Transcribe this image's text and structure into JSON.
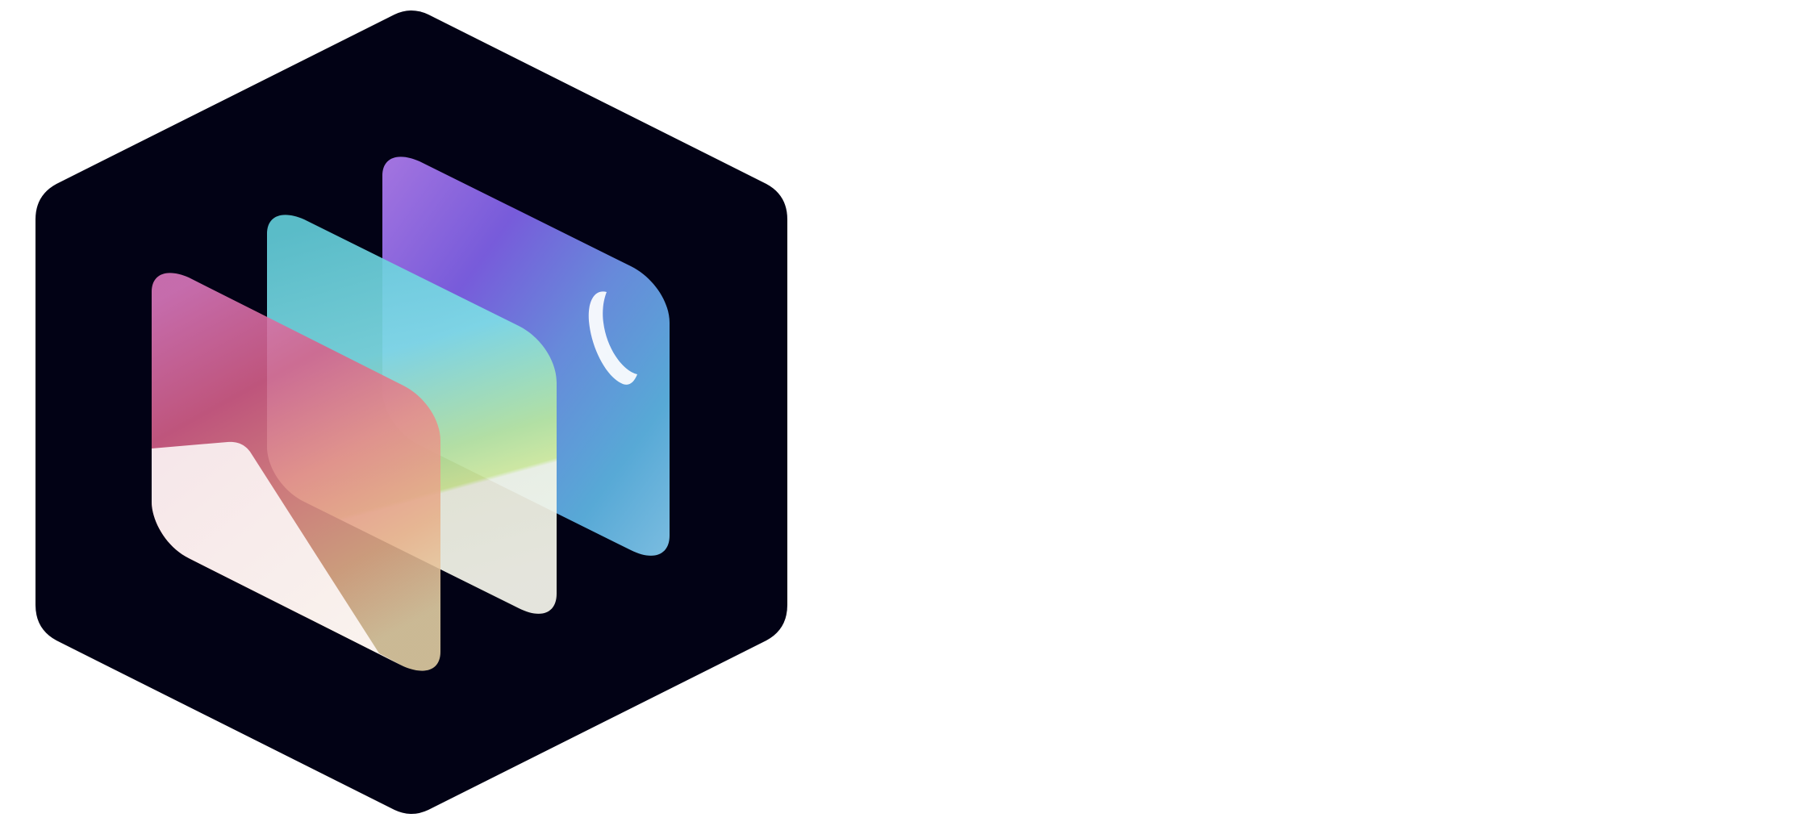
{
  "logo": {
    "icon": "layered-cards-hexagon-icon",
    "background_color": "#ffffff",
    "hexagon_color": "#020215",
    "back_card": {
      "icon": "moon-icon",
      "gradient_colors": [
        "#a978e6",
        "#7b5ee0",
        "#6a8ee0",
        "#5aaedc",
        "#7ec2e6"
      ],
      "moon_color": "#ffffff"
    },
    "middle_card": {
      "gradient_colors": [
        "#7ee0e6",
        "#62ccd8",
        "#9ee0c8",
        "#c4e67e",
        "#f6f7ea"
      ]
    },
    "front_card": {
      "gradient_colors": [
        "#e07ac0",
        "#d8608a",
        "#e88a8a",
        "#e6b08a",
        "#e6d2a6"
      ],
      "lower_color": "#faf0f0"
    }
  }
}
